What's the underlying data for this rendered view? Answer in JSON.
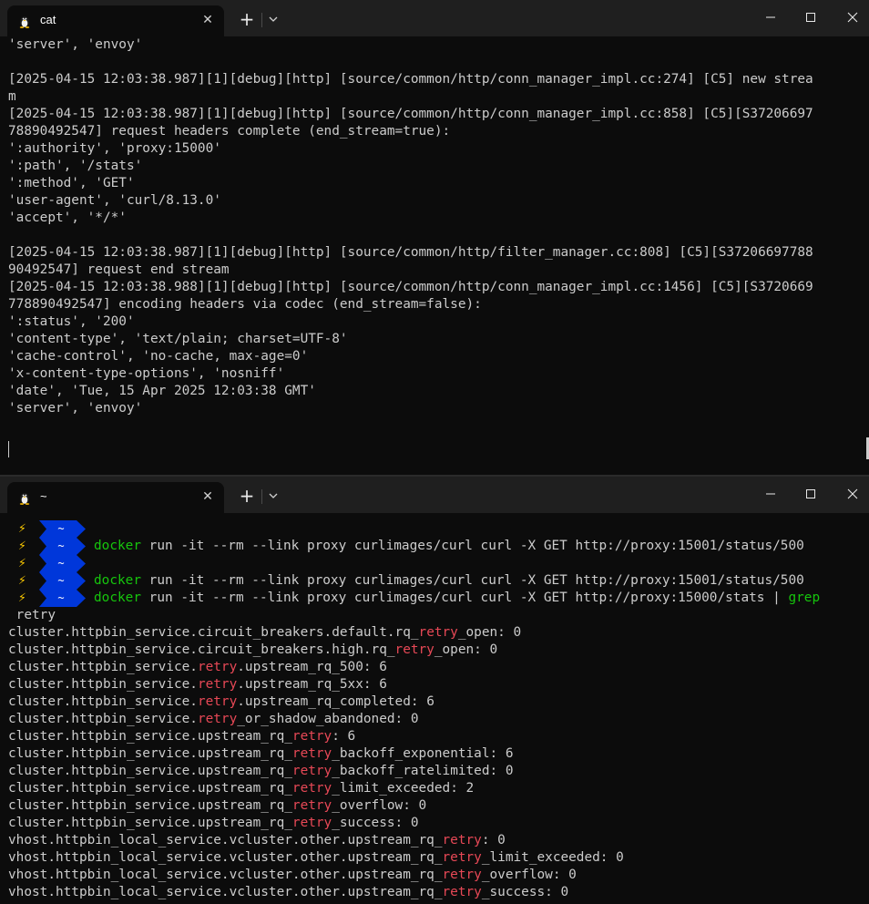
{
  "top_window": {
    "tab": {
      "title": "cat",
      "icon": "linux-penguin-icon"
    },
    "controls": {
      "new_tab": "+",
      "close_tab": "✕"
    },
    "log_lines": [
      "'server', 'envoy'",
      "",
      "[2025-04-15 12:03:38.987][1][debug][http] [source/common/http/conn_manager_impl.cc:274] [C5] new strea",
      "m",
      "[2025-04-15 12:03:38.987][1][debug][http] [source/common/http/conn_manager_impl.cc:858] [C5][S37206697",
      "78890492547] request headers complete (end_stream=true):",
      "':authority', 'proxy:15000'",
      "':path', '/stats'",
      "':method', 'GET'",
      "'user-agent', 'curl/8.13.0'",
      "'accept', '*/*'",
      "",
      "[2025-04-15 12:03:38.987][1][debug][http] [source/common/http/filter_manager.cc:808] [C5][S37206697788",
      "90492547] request end stream",
      "[2025-04-15 12:03:38.988][1][debug][http] [source/common/http/conn_manager_impl.cc:1456] [C5][S3720669",
      "778890492547] encoding headers via codec (end_stream=false):",
      "':status', '200'",
      "'content-type', 'text/plain; charset=UTF-8'",
      "'cache-control', 'no-cache, max-age=0'",
      "'x-content-type-options', 'nosniff'",
      "'date', 'Tue, 15 Apr 2025 12:03:38 GMT'",
      "'server', 'envoy'"
    ]
  },
  "bottom_window": {
    "tab": {
      "title": "~",
      "icon": "linux-penguin-icon"
    },
    "controls": {
      "new_tab": "+",
      "close_tab": "✕"
    },
    "prompt": {
      "bolt": "⚡",
      "dir": "~",
      "colors": {
        "bolt": "#ffcc00",
        "segment": "#0037da",
        "command": "#16c60c",
        "match": "#e74856"
      }
    },
    "commands": [
      {
        "cmd": "",
        "args": ""
      },
      {
        "cmd": "docker",
        "args": " run -it --rm --link proxy curlimages/curl curl -X GET http://proxy:15001/status/500"
      },
      {
        "cmd": "",
        "args": ""
      },
      {
        "cmd": "docker",
        "args": " run -it --rm --link proxy curlimages/curl curl -X GET http://proxy:15001/status/500"
      },
      {
        "cmd": "docker",
        "args": " run -it --rm --link proxy curlimages/curl curl -X GET http://proxy:15000/stats | ",
        "pipe": "grep"
      }
    ],
    "wrap": " retry",
    "match": "retry",
    "stats": [
      {
        "a": "cluster.httpbin_service.circuit_breakers.default.rq_",
        "b": "_open: 0"
      },
      {
        "a": "cluster.httpbin_service.circuit_breakers.high.rq_",
        "b": "_open: 0"
      },
      {
        "a": "cluster.httpbin_service.",
        "b": ".upstream_rq_500: 6"
      },
      {
        "a": "cluster.httpbin_service.",
        "b": ".upstream_rq_5xx: 6"
      },
      {
        "a": "cluster.httpbin_service.",
        "b": ".upstream_rq_completed: 6"
      },
      {
        "a": "cluster.httpbin_service.",
        "b": "_or_shadow_abandoned: 0"
      },
      {
        "a": "cluster.httpbin_service.upstream_rq_",
        "b": ": 6"
      },
      {
        "a": "cluster.httpbin_service.upstream_rq_",
        "b": "_backoff_exponential: 6"
      },
      {
        "a": "cluster.httpbin_service.upstream_rq_",
        "b": "_backoff_ratelimited: 0"
      },
      {
        "a": "cluster.httpbin_service.upstream_rq_",
        "b": "_limit_exceeded: 2"
      },
      {
        "a": "cluster.httpbin_service.upstream_rq_",
        "b": "_overflow: 0"
      },
      {
        "a": "cluster.httpbin_service.upstream_rq_",
        "b": "_success: 0"
      },
      {
        "a": "vhost.httpbin_local_service.vcluster.other.upstream_rq_",
        "b": ": 0"
      },
      {
        "a": "vhost.httpbin_local_service.vcluster.other.upstream_rq_",
        "b": "_limit_exceeded: 0"
      },
      {
        "a": "vhost.httpbin_local_service.vcluster.other.upstream_rq_",
        "b": "_overflow: 0"
      },
      {
        "a": "vhost.httpbin_local_service.vcluster.other.upstream_rq_",
        "b": "_success: 0"
      }
    ]
  }
}
